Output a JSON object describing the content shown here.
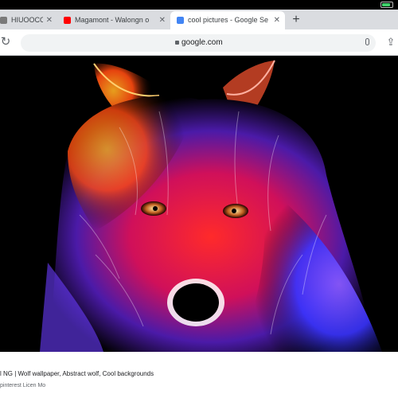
{
  "status_bar": {
    "battery_level": 0.85,
    "battery_color": "#3fd16a"
  },
  "tabs": [
    {
      "label": "HIUOOCO Pu",
      "favicon": "page-icon",
      "favicon_color": "#7a7a7a",
      "state": "inactive"
    },
    {
      "label": "Magamont - Walongn o",
      "favicon": "youtube-icon",
      "favicon_color": "#ff0000",
      "state": "inactive"
    },
    {
      "label": "cool pictures - Google Se",
      "favicon": "google-icon",
      "favicon_color": "#4285f4",
      "state": "active"
    }
  ],
  "toolbar": {
    "url": "google.com"
  },
  "content": {
    "image_description_icon": "wolf-image"
  },
  "caption": {
    "title": "l NG | Wolf wallpaper, Abstract wolf, Cool backgrounds",
    "source": "pinterest Licen Mo"
  },
  "colors": {
    "tabbar": "#dadce0",
    "active_tab": "#ffffff",
    "omnibox": "#f1f3f4"
  }
}
